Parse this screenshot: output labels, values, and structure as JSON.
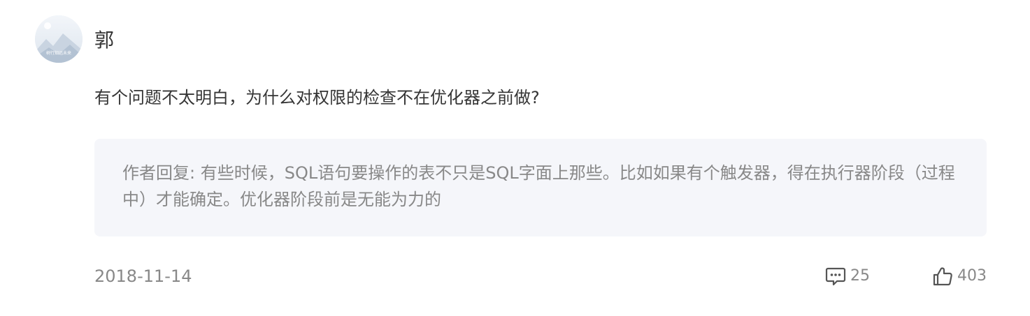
{
  "comment": {
    "avatar": {
      "caption": "树行知远未来"
    },
    "username": "郭",
    "content": "有个问题不太明白，为什么对权限的检查不在优化器之前做?",
    "reply": {
      "text": "作者回复: 有些时候，SQL语句要操作的表不只是SQL字面上那些。比如如果有个触发器，得在执行器阶段（过程中）才能确定。优化器阶段前是无能为力的"
    },
    "footer": {
      "date": "2018-11-14",
      "comment_count": "25",
      "like_count": "403"
    }
  },
  "icons": {
    "comment": "comment-bubble-icon",
    "like": "thumbs-up-icon"
  },
  "colors": {
    "text_primary": "#353535",
    "text_secondary": "#888888",
    "reply_background": "#f5f6fa"
  }
}
